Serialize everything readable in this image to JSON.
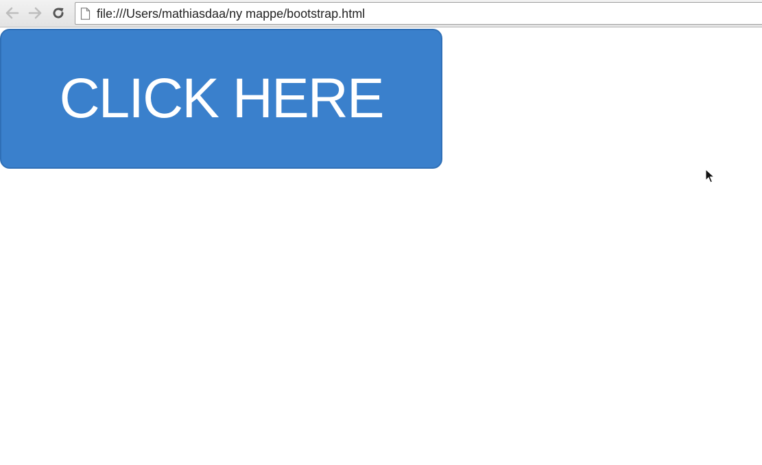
{
  "browser": {
    "url": "file:///Users/mathiasdaa/ny mappe/bootstrap.html",
    "back_icon": "arrow-left-icon",
    "forward_icon": "arrow-right-icon",
    "reload_icon": "reload-icon",
    "page_icon": "document-icon"
  },
  "page": {
    "button_label": "CLICK HERE",
    "button_color": "#3a80cc",
    "button_border_color": "#2f6fb6",
    "button_text_color": "#ffffff"
  }
}
